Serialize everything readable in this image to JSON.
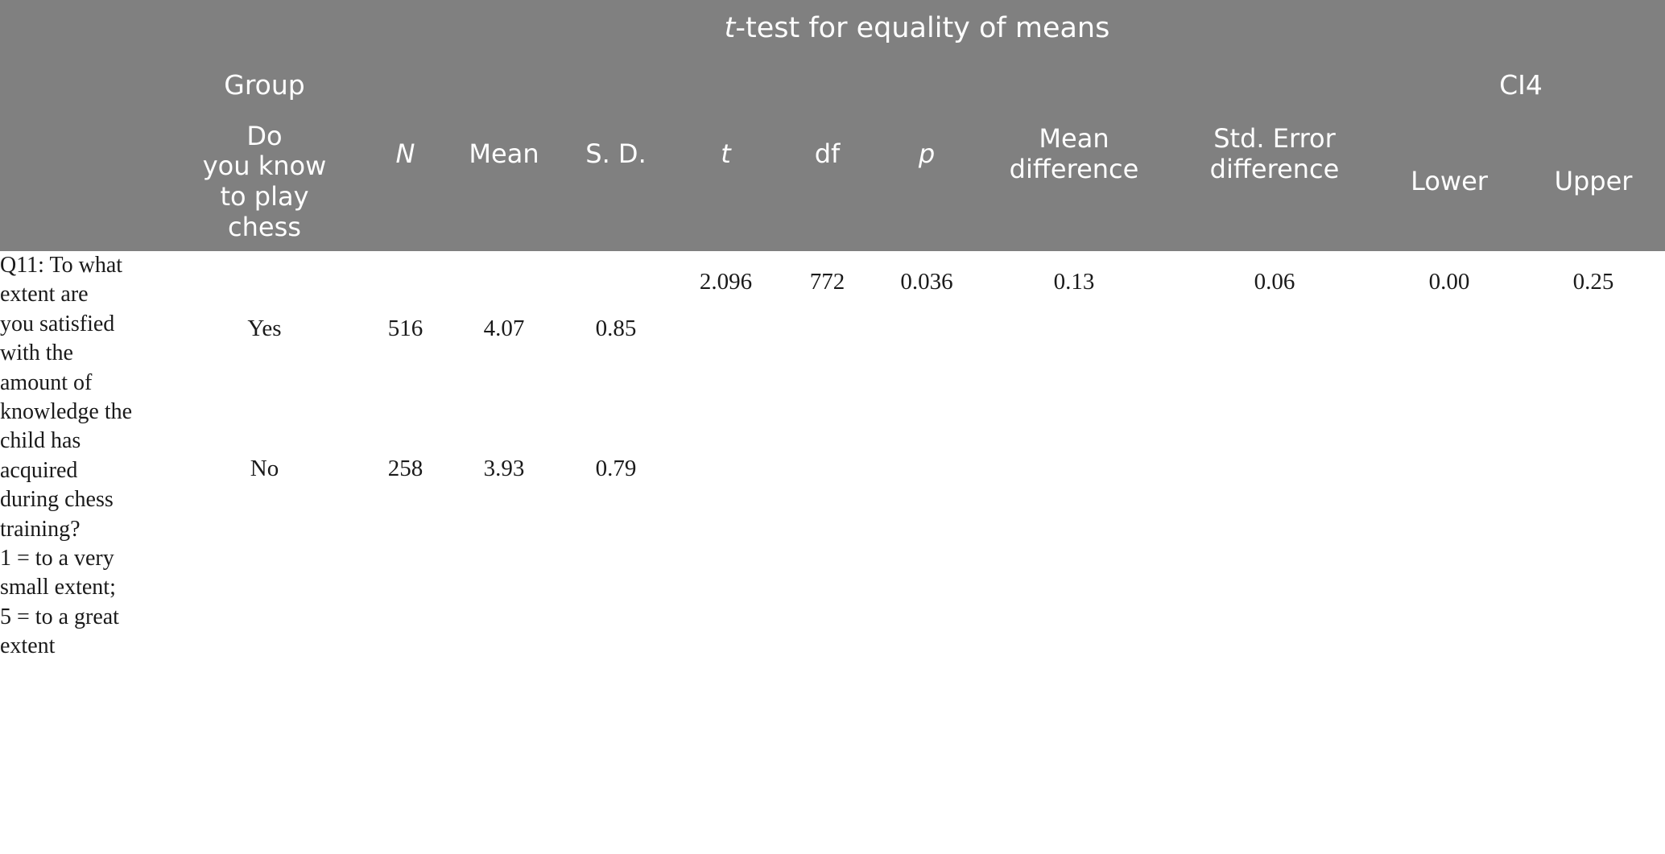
{
  "table": {
    "header": {
      "title_prefix": "t",
      "title_rest": "-test for equality of means",
      "group_label": "Group",
      "ci_label": "CI4",
      "columns": {
        "group_sub": "Do\nyou know\nto play\nchess",
        "group_sub_lines": [
          "Do",
          "you know",
          "to play",
          "chess"
        ],
        "n": "N",
        "mean": "Mean",
        "sd": "S. D.",
        "t": "t",
        "df": "df",
        "p": "p",
        "mean_difference_lines": [
          "Mean",
          "difference"
        ],
        "std_error_difference_lines": [
          "Std. Error",
          "difference"
        ],
        "lower": "Lower",
        "upper": "Upper"
      }
    },
    "question": {
      "lines": [
        "Q11: To what",
        "extent are",
        "you satisfied",
        "with the",
        "amount of",
        "knowledge the",
        "child has",
        "acquired",
        "during chess",
        "training?",
        "1 = to a very",
        "small extent;",
        "5 = to a great",
        "extent"
      ]
    },
    "rows": [
      {
        "group": "Yes",
        "n": "516",
        "mean": "4.07",
        "sd": "0.85"
      },
      {
        "group": "No",
        "n": "258",
        "mean": "3.93",
        "sd": "0.79"
      }
    ],
    "stats": {
      "t": "2.096",
      "df": "772",
      "p": "0.036",
      "mean_difference": "0.13",
      "std_error_difference": "0.06",
      "ci_lower": "0.00",
      "ci_upper": "0.25"
    },
    "colors": {
      "header_background": "#808080",
      "header_text": "#ffffff",
      "border": "#c9c9c9",
      "body_background": "#ffffff",
      "body_text": "#1a1a1a"
    }
  }
}
